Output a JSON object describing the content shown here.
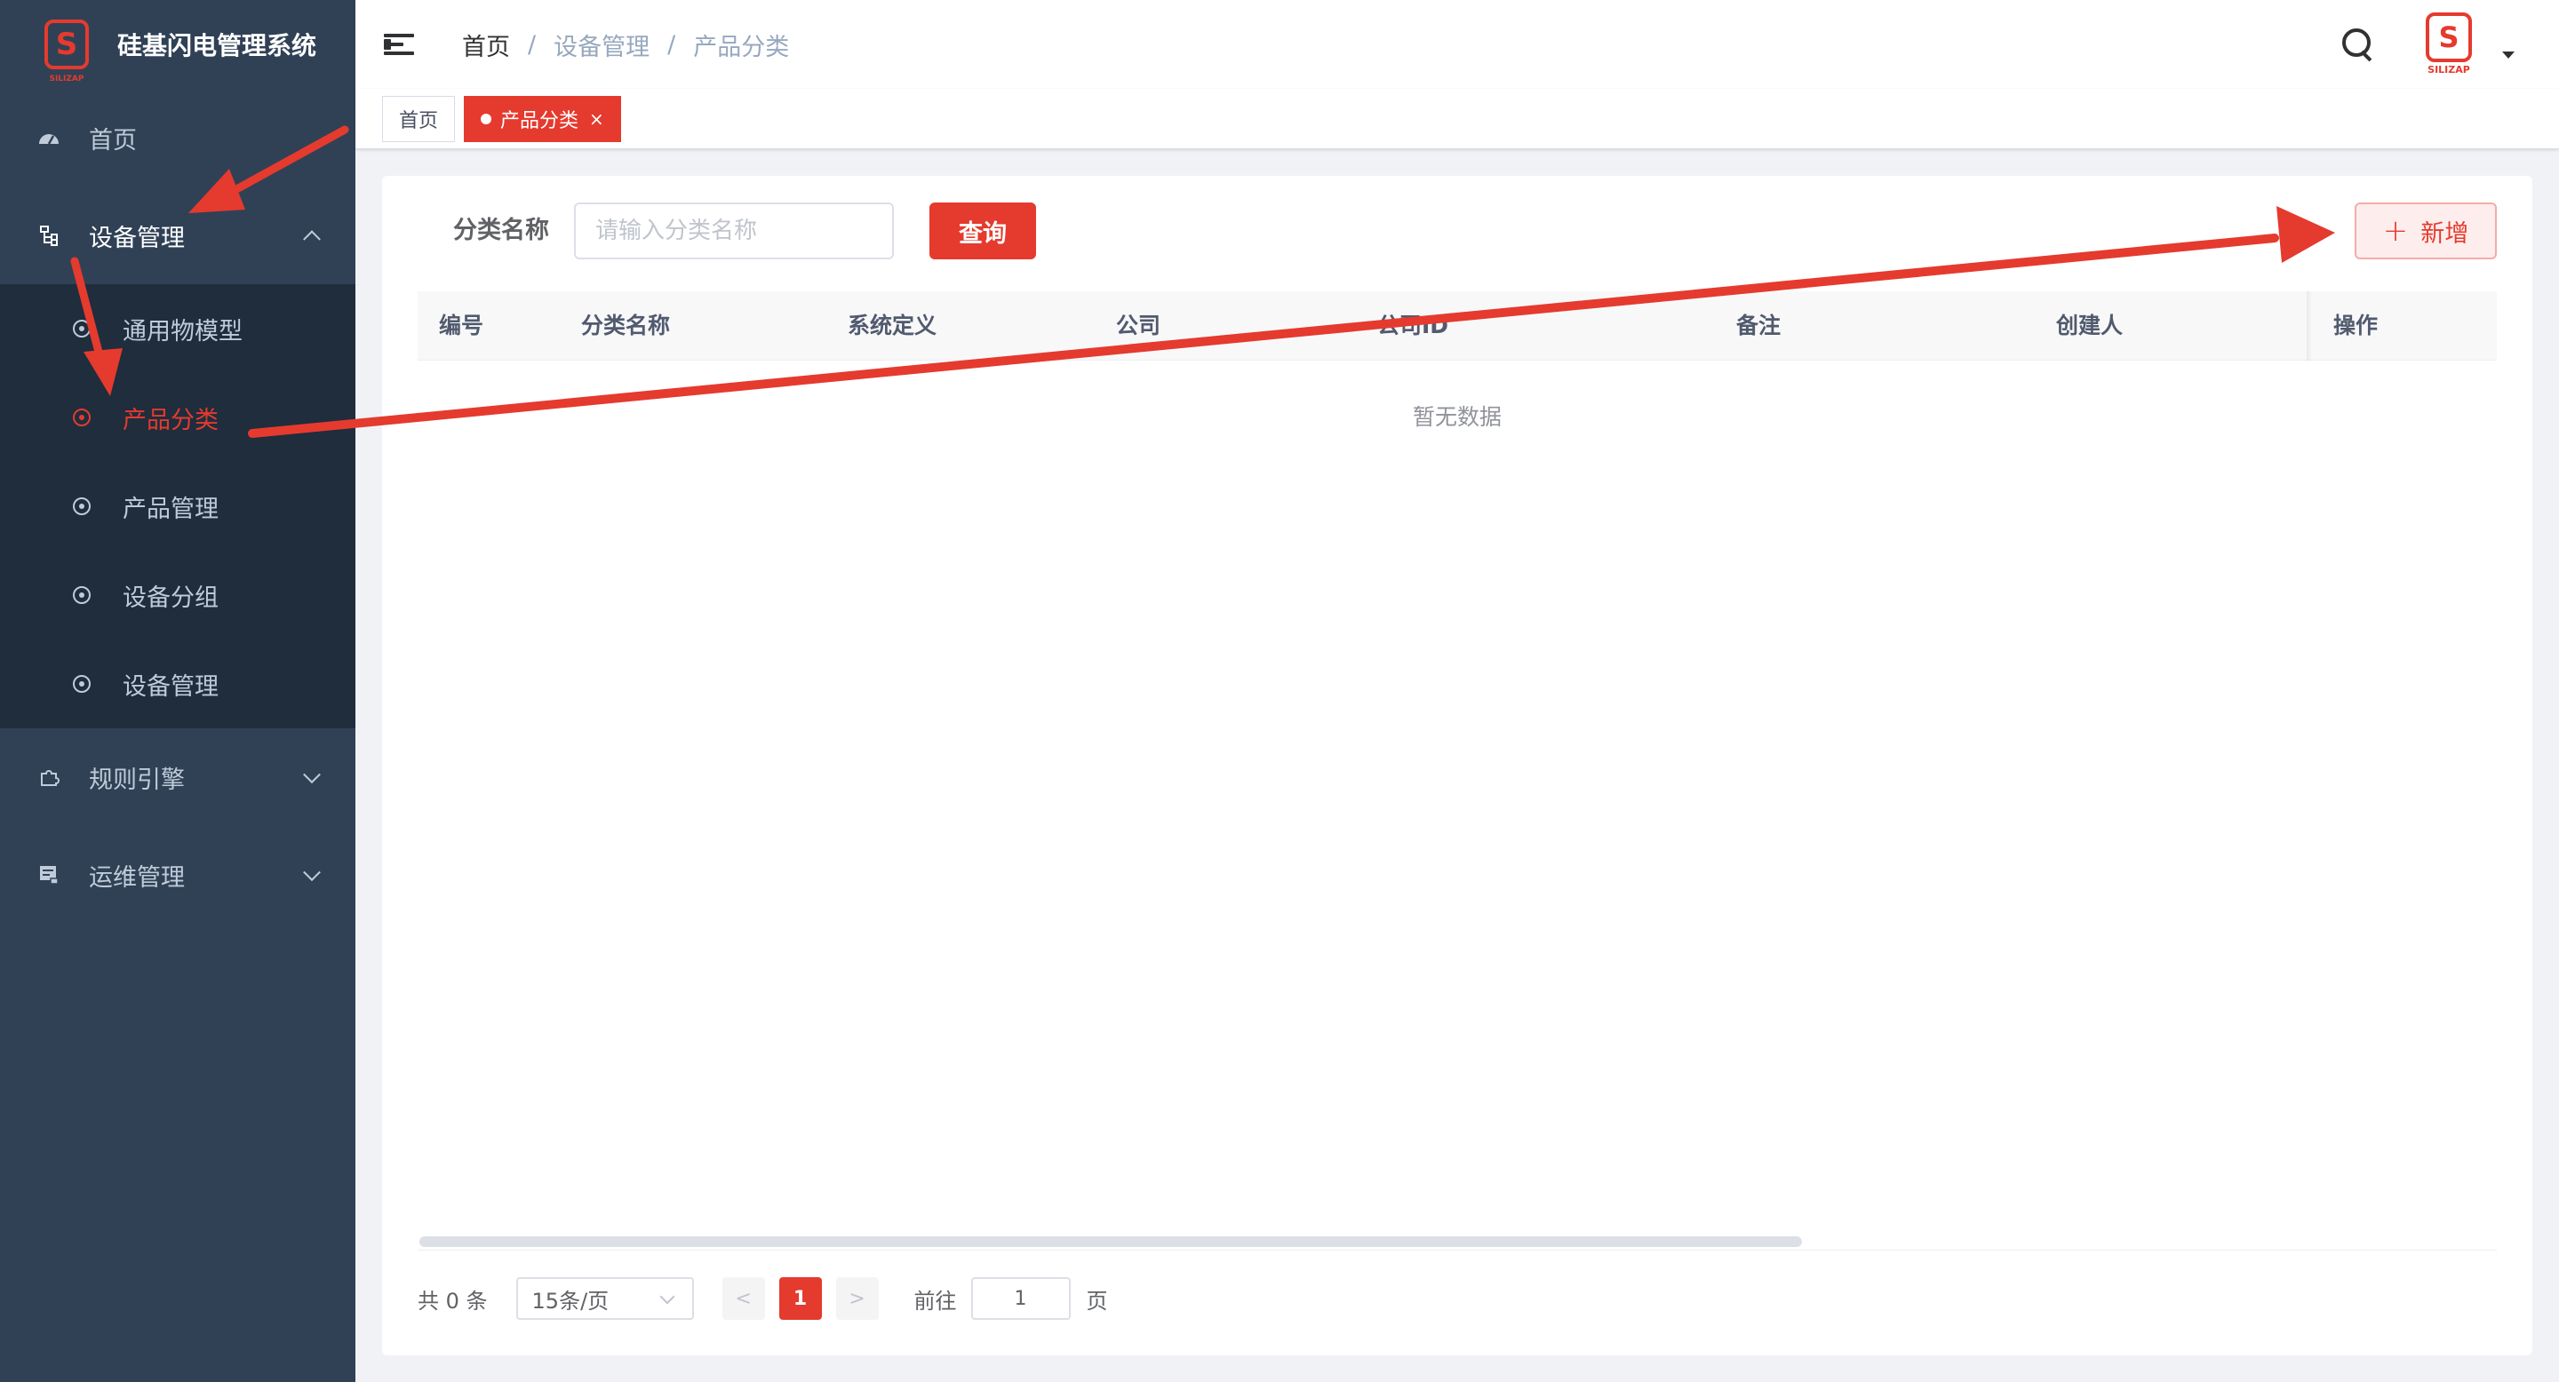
{
  "app": {
    "title": "硅基闪电管理系统",
    "logo_brand": "SILIZAP",
    "logo_glyph": "S"
  },
  "colors": {
    "accent": "#e53a2e",
    "sidebar_bg": "#304156",
    "submenu_bg": "#1f2d3d",
    "annotation_arrow": "#e53a2e"
  },
  "sidebar": {
    "items": [
      {
        "label": "首页",
        "icon": "dashboard-icon",
        "expanded": false
      },
      {
        "label": "设备管理",
        "icon": "tree-icon",
        "expanded": true,
        "children": [
          {
            "label": "通用物模型",
            "icon": "circle-icon",
            "active": false
          },
          {
            "label": "产品分类",
            "icon": "circle-icon",
            "active": true
          },
          {
            "label": "产品管理",
            "icon": "circle-icon",
            "active": false
          },
          {
            "label": "设备分组",
            "icon": "circle-icon",
            "active": false
          },
          {
            "label": "设备管理",
            "icon": "circle-icon",
            "active": false
          }
        ]
      },
      {
        "label": "规则引擎",
        "icon": "puzzle-icon",
        "expanded": false
      },
      {
        "label": "运维管理",
        "icon": "monitor-icon",
        "expanded": false
      }
    ]
  },
  "header": {
    "breadcrumb": [
      "首页",
      "设备管理",
      "产品分类"
    ],
    "separator": "/"
  },
  "tags": [
    {
      "label": "首页",
      "active": false
    },
    {
      "label": "产品分类",
      "active": true,
      "close": "×"
    }
  ],
  "filter": {
    "label": "分类名称",
    "placeholder": "请输入分类名称",
    "value": "",
    "query_label": "查询",
    "add_label": "新增",
    "add_icon": "+"
  },
  "table": {
    "columns": [
      "编号",
      "分类名称",
      "系统定义",
      "公司",
      "公司ID",
      "备注",
      "创建人",
      "操作"
    ],
    "rows": [],
    "empty_text": "暂无数据"
  },
  "pagination": {
    "total_text": "共 0 条",
    "page_size": "15条/页",
    "prev": "<",
    "next": ">",
    "current_page": "1",
    "jump_prefix": "前往",
    "jump_value": "1",
    "jump_suffix": "页"
  }
}
